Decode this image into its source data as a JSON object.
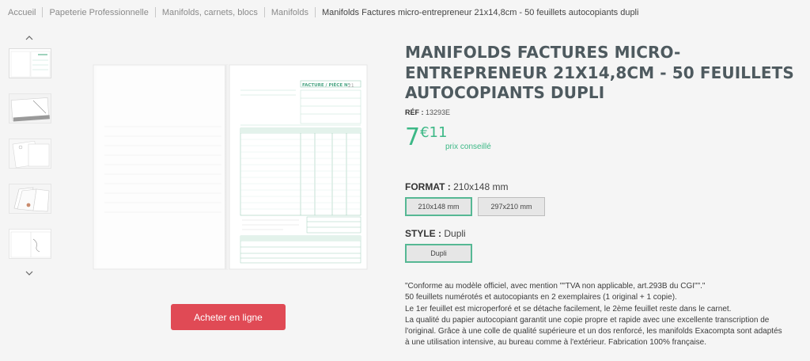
{
  "breadcrumb": [
    "Accueil",
    "Papeterie Professionnelle",
    "Manifolds, carnets, blocs",
    "Manifolds",
    "Manifolds Factures micro-entrepreneur 21x14,8cm - 50 feuillets autocopiants dupli"
  ],
  "gallery": {
    "up_icon": "chevron-up-icon",
    "down_icon": "chevron-down-icon",
    "thumbnail_count": 5
  },
  "product": {
    "title": "MANIFOLDS FACTURES MICRO-ENTREPRENEUR 21X14,8CM - 50 FEUILLETS AUTOCOPIANTS DUPLI",
    "ref_label": "RÉF :",
    "ref_value": "13293E",
    "price_int": "7",
    "price_dec": "€11",
    "price_note": "prix conseillé",
    "format_label": "FORMAT :",
    "format_value": "210x148 mm",
    "format_options": [
      "210x148 mm",
      "297x210 mm"
    ],
    "style_label": "STYLE :",
    "style_value": "Dupli",
    "style_options": [
      "Dupli"
    ],
    "buy_label": "Acheter en ligne",
    "description": [
      "\"Conforme au modèle officiel, avec mention \"\"TVA non applicable, art.293B du CGI\"\".\"",
      "50 feuillets numérotés et autocopiants en 2 exemplaires (1 original + 1 copie).",
      "Le 1er feuillet est microperforé et se détache facilement, le 2ème feuillet reste dans le carnet.",
      "La qualité du papier autocopiant garantit une copie propre et rapide avec une excellente transcription de",
      "l'original. Grâce à une colle de qualité supérieure et un dos renforcé, les manifolds Exacompta sont adaptés",
      "à une utilisation intensive, au bureau comme à l'extérieur. Fabrication 100% française."
    ]
  },
  "image_text": {
    "form_header": "FACTURE / PIÈCE N°",
    "form_number": "21"
  },
  "colors": {
    "accent_green": "#3cb886",
    "buy_red": "#e04a55",
    "title": "#4e5a5f"
  }
}
